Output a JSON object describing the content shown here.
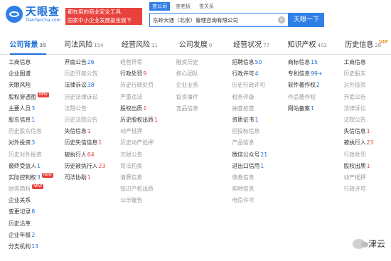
{
  "header": {
    "logo_cn": "天眼查",
    "logo_en": "TianYanCha.com",
    "slogan_line1": "都在用的商业安全工具",
    "slogan_line2": "国家中小企业发展基金旗下",
    "search_tabs": [
      "查公司",
      "查老板",
      "查关系"
    ],
    "search_value": "东岭大通（北京）管理咨询有限公司",
    "search_button": "天眼一下"
  },
  "tabs": [
    {
      "label": "公司背景",
      "count": "35"
    },
    {
      "label": "司法风险",
      "count": "154"
    },
    {
      "label": "经营风险",
      "count": "11"
    },
    {
      "label": "公司发展",
      "count": "0"
    },
    {
      "label": "经营状况",
      "count": "77"
    },
    {
      "label": "知识产权",
      "count": "403"
    },
    {
      "label": "历史信息",
      "count": "26",
      "vip": "VIP"
    }
  ],
  "columns": [
    [
      {
        "label": "工商信息",
        "active": true
      },
      {
        "label": "企业图谱",
        "active": true
      },
      {
        "label": "天眼风险",
        "active": true
      },
      {
        "label": "股权穿透图",
        "active": true,
        "badge": "NEW"
      },
      {
        "label": "主要人员",
        "count": "3",
        "active": true
      },
      {
        "label": "股东信息",
        "count": "1",
        "active": true
      },
      {
        "label": "历史股东信息",
        "active": false
      },
      {
        "label": "对外投资",
        "count": "3",
        "active": true
      },
      {
        "label": "历史对外投资",
        "active": false
      },
      {
        "label": "最终受益人",
        "count": "1",
        "active": true
      },
      {
        "label": "实际控制权",
        "count": "3",
        "active": true,
        "badge": "NEW"
      },
      {
        "label": "财务简析",
        "active": false,
        "badge": "NEW"
      },
      {
        "label": "企业关系",
        "active": true
      },
      {
        "label": "变更记录",
        "count": "8",
        "active": true
      },
      {
        "label": "历史沿革",
        "active": true
      },
      {
        "label": "企业年报",
        "count": "2",
        "active": true
      },
      {
        "label": "分支机构",
        "count": "13",
        "active": true
      }
    ],
    [
      {
        "label": "开庭公告",
        "count": "26",
        "active": true
      },
      {
        "label": "历史开庭公告",
        "active": false
      },
      {
        "label": "法律诉讼",
        "count": "38",
        "active": true
      },
      {
        "label": "历史法律诉讼",
        "active": false
      },
      {
        "label": "法院公告",
        "active": false
      },
      {
        "label": "历史法院公告",
        "active": false
      },
      {
        "label": "失信信息",
        "count": "1",
        "active": true,
        "red": true
      },
      {
        "label": "历史失信信息",
        "count": "1",
        "active": true,
        "red": true
      },
      {
        "label": "被执行人",
        "count": "64",
        "active": true,
        "red": true
      },
      {
        "label": "历史被执行人",
        "count": "23",
        "active": true,
        "red": true
      },
      {
        "label": "司法协助",
        "count": "1",
        "active": true,
        "red": true
      }
    ],
    [
      {
        "label": "经营异常",
        "active": false
      },
      {
        "label": "行政处罚",
        "count": "9",
        "active": true,
        "red": true
      },
      {
        "label": "历史行政处罚",
        "active": false
      },
      {
        "label": "严重违法",
        "active": false
      },
      {
        "label": "股权出质",
        "count": "1",
        "active": true,
        "red": true
      },
      {
        "label": "历史股权出质",
        "count": "1",
        "active": true,
        "red": true
      },
      {
        "label": "动产抵押",
        "active": false
      },
      {
        "label": "历史动产抵押",
        "active": false
      },
      {
        "label": "欠税公告",
        "active": false
      },
      {
        "label": "司法拍卖",
        "active": false
      },
      {
        "label": "清算信息",
        "active": false
      },
      {
        "label": "知识产权出质",
        "active": false
      },
      {
        "label": "公示催告",
        "active": false
      }
    ],
    [
      {
        "label": "融资历史",
        "active": false
      },
      {
        "label": "核心团队",
        "active": false
      },
      {
        "label": "企业业务",
        "active": false
      },
      {
        "label": "投资事件",
        "active": false
      },
      {
        "label": "竞品信息",
        "active": false
      }
    ],
    [
      {
        "label": "招聘信息",
        "count": "50",
        "active": true
      },
      {
        "label": "行政许可",
        "count": "4",
        "active": true
      },
      {
        "label": "历史行政许可",
        "active": false
      },
      {
        "label": "税务评级",
        "active": false
      },
      {
        "label": "抽查检查",
        "active": false
      },
      {
        "label": "资质证书",
        "count": "1",
        "active": true
      },
      {
        "label": "招投标信息",
        "active": false
      },
      {
        "label": "产品信息",
        "active": false
      },
      {
        "label": "微信公众号",
        "count": "21",
        "active": true
      },
      {
        "label": "进出口信用",
        "count": "1",
        "active": true
      },
      {
        "label": "债券信息",
        "active": false
      },
      {
        "label": "购地信息",
        "active": false
      },
      {
        "label": "电信许可",
        "active": false
      }
    ],
    [
      {
        "label": "商标信息",
        "count": "15",
        "active": true
      },
      {
        "label": "专利信息",
        "count": "99+",
        "active": true
      },
      {
        "label": "软件著作权",
        "count": "2",
        "active": true
      },
      {
        "label": "作品著作权",
        "active": false
      },
      {
        "label": "网站备案",
        "count": "1",
        "active": true
      }
    ],
    [
      {
        "label": "工商信息",
        "active": true
      },
      {
        "label": "历史股东",
        "active": false
      },
      {
        "label": "对外投资",
        "active": false
      },
      {
        "label": "开庭公告",
        "active": false
      },
      {
        "label": "法律诉讼",
        "active": false
      },
      {
        "label": "法院公告",
        "active": false
      },
      {
        "label": "失信信息",
        "count": "1",
        "active": true,
        "red": true
      },
      {
        "label": "被执行人",
        "count": "23",
        "active": true,
        "red": true
      },
      {
        "label": "行政处罚",
        "active": false
      },
      {
        "label": "股权出质",
        "count": "1",
        "active": true,
        "red": true
      },
      {
        "label": "动产抵押",
        "active": false
      },
      {
        "label": "行政许可",
        "active": false
      }
    ]
  ],
  "watermark": "津云"
}
